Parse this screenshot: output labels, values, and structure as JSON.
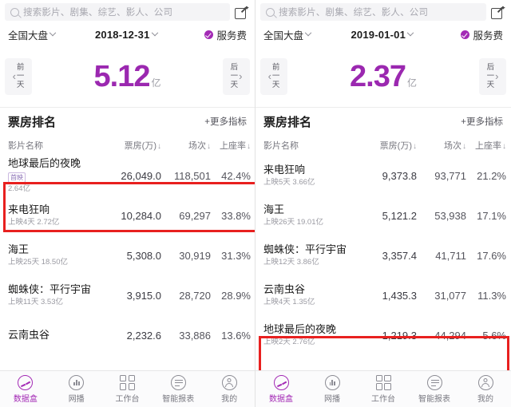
{
  "panels": [
    {
      "search": {
        "placeholder": "搜索影片、剧集、综艺、影人、公司"
      },
      "filter": {
        "region": "全国大盘",
        "date": "2018-12-31",
        "fee": "服务费"
      },
      "hero": {
        "prev_l1": "前",
        "prev_l2": "一",
        "prev_l3": "天",
        "next_l1": "后",
        "next_l2": "一",
        "next_l3": "天",
        "prev_chev": "‹",
        "next_chev": "›",
        "value": "5.12",
        "unit": "亿"
      },
      "rank": {
        "title": "票房排名",
        "more": "+更多指标",
        "columns": [
          "影片名称",
          "票房(万)",
          "场次",
          "上座率"
        ],
        "sort_glyph": "↓"
      },
      "rows": [
        {
          "title": "地球最后的夜晚",
          "badge": "首映",
          "sub": "2.64亿",
          "box_office": "26,049.0",
          "sessions": "118,501",
          "rate": "42.4%",
          "highlight": true
        },
        {
          "title": "来电狂响",
          "badge": "",
          "sub": "上映4天 2.72亿",
          "box_office": "10,284.0",
          "sessions": "69,297",
          "rate": "33.8%",
          "highlight": false
        },
        {
          "title": "海王",
          "badge": "",
          "sub": "上映25天 18.50亿",
          "box_office": "5,308.0",
          "sessions": "30,919",
          "rate": "31.3%",
          "highlight": false
        },
        {
          "title": "蜘蛛侠：平行宇宙",
          "badge": "",
          "sub": "上映11天 3.53亿",
          "box_office": "3,915.0",
          "sessions": "28,720",
          "rate": "28.9%",
          "highlight": false
        },
        {
          "title": "云南虫谷",
          "badge": "",
          "sub": "",
          "box_office": "2,232.6",
          "sessions": "33,886",
          "rate": "13.6%",
          "highlight": false
        }
      ],
      "tabs": [
        {
          "label": "数据盒",
          "icon": "databox-icon",
          "active": true
        },
        {
          "label": "网播",
          "icon": "chart-circle-icon",
          "active": false
        },
        {
          "label": "工作台",
          "icon": "grid-icon",
          "active": false
        },
        {
          "label": "智能报表",
          "icon": "report-icon",
          "active": false
        },
        {
          "label": "我的",
          "icon": "profile-icon",
          "active": false
        }
      ]
    },
    {
      "search": {
        "placeholder": "搜索影片、剧集、综艺、影人、公司"
      },
      "filter": {
        "region": "全国大盘",
        "date": "2019-01-01",
        "fee": "服务费"
      },
      "hero": {
        "prev_l1": "前",
        "prev_l2": "一",
        "prev_l3": "天",
        "next_l1": "后",
        "next_l2": "一",
        "next_l3": "天",
        "prev_chev": "‹",
        "next_chev": "›",
        "value": "2.37",
        "unit": "亿"
      },
      "rank": {
        "title": "票房排名",
        "more": "+更多指标",
        "columns": [
          "影片名称",
          "票房(万)",
          "场次",
          "上座率"
        ],
        "sort_glyph": "↓"
      },
      "rows": [
        {
          "title": "来电狂响",
          "badge": "",
          "sub": "上映5天 3.66亿",
          "box_office": "9,373.8",
          "sessions": "93,771",
          "rate": "21.2%",
          "highlight": false
        },
        {
          "title": "海王",
          "badge": "",
          "sub": "上映26天 19.01亿",
          "box_office": "5,121.2",
          "sessions": "53,938",
          "rate": "17.1%",
          "highlight": false
        },
        {
          "title": "蜘蛛侠：平行宇宙",
          "badge": "",
          "sub": "上映12天 3.86亿",
          "box_office": "3,357.4",
          "sessions": "41,711",
          "rate": "17.6%",
          "highlight": false
        },
        {
          "title": "云南虫谷",
          "badge": "",
          "sub": "上映4天 1.35亿",
          "box_office": "1,435.3",
          "sessions": "31,077",
          "rate": "11.3%",
          "highlight": false
        },
        {
          "title": "地球最后的夜晚",
          "badge": "",
          "sub": "上映2天 2.76亿",
          "box_office": "1,219.3",
          "sessions": "44,294",
          "rate": "5.6%",
          "highlight": true
        }
      ],
      "tabs": [
        {
          "label": "数据盒",
          "icon": "databox-icon",
          "active": true
        },
        {
          "label": "网播",
          "icon": "chart-circle-icon",
          "active": false
        },
        {
          "label": "工作台",
          "icon": "grid-icon",
          "active": false
        },
        {
          "label": "智能报表",
          "icon": "report-icon",
          "active": false
        },
        {
          "label": "我的",
          "icon": "profile-icon",
          "active": false
        }
      ]
    }
  ],
  "colors": {
    "accent": "#9b28b0",
    "highlight_box": "#e8201f",
    "muted": "#9a9aa2"
  }
}
